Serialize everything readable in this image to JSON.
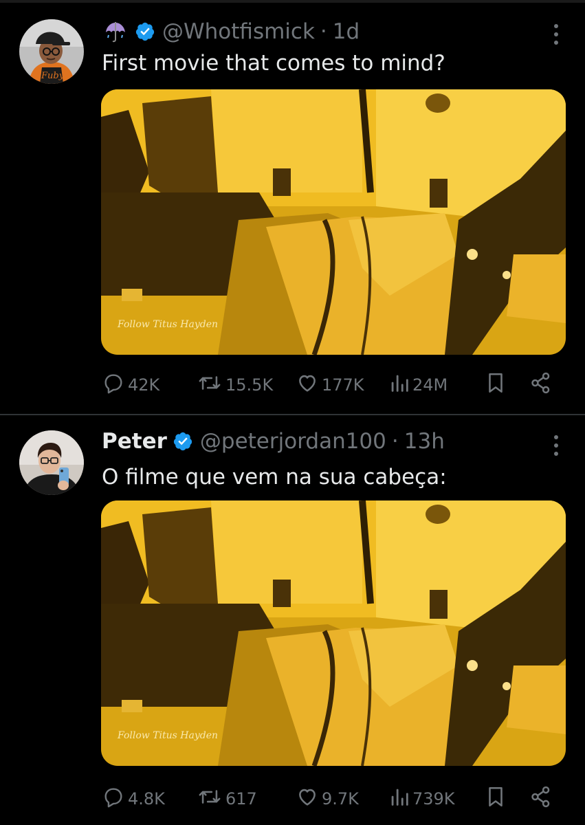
{
  "tweets": [
    {
      "display_name": "",
      "name_emoji": "umbrella-with-rain-icon",
      "handle": "@Whotfismick",
      "separator": "·",
      "time": "1d",
      "text": "First movie that comes to mind?",
      "media_watermark": "Follow Titus Hayden",
      "stats": {
        "replies": "42K",
        "reposts": "15.5K",
        "likes": "177K",
        "views": "24M"
      }
    },
    {
      "display_name": "Peter",
      "handle": "@peterjordan100",
      "separator": "·",
      "time": "13h",
      "text": "O filme que vem na sua cabeça:",
      "media_watermark": "Follow Titus Hayden",
      "stats": {
        "replies": "4.8K",
        "reposts": "617",
        "likes": "9.7K",
        "views": "739K"
      }
    }
  ],
  "colors": {
    "background": "#000000",
    "text_primary": "#e7e9ea",
    "text_secondary": "#71767b",
    "verified_blue": "#1d9bf0",
    "divider": "#2f3336",
    "media_gold": "#d9a514"
  }
}
